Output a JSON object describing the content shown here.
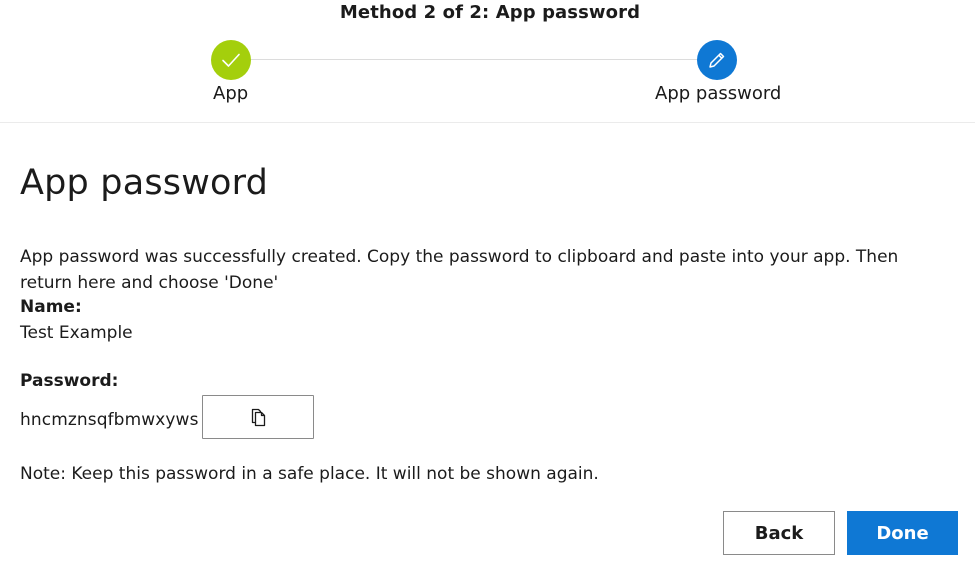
{
  "wizard": {
    "method_title": "Method 2 of 2: App password",
    "steps": [
      {
        "label": "App",
        "status": "completed",
        "icon": "checkmark-icon",
        "color": "#a4cf0c"
      },
      {
        "label": "App password",
        "status": "current",
        "icon": "pencil-icon",
        "color": "#0f78d4"
      }
    ]
  },
  "content": {
    "title": "App password",
    "description": "App password was successfully created. Copy the password to clipboard and paste into your app. Then return here and choose 'Done'",
    "name_label": "Name:",
    "name_value": "Test Example",
    "password_label": "Password:",
    "password_value": "hncmznsqfbmwxyws",
    "copy_button_icon": "copy-icon",
    "note": "Note: Keep this password in a safe place. It will not be shown again."
  },
  "actions": {
    "back_label": "Back",
    "done_label": "Done",
    "primary_color": "#0f78d4"
  }
}
